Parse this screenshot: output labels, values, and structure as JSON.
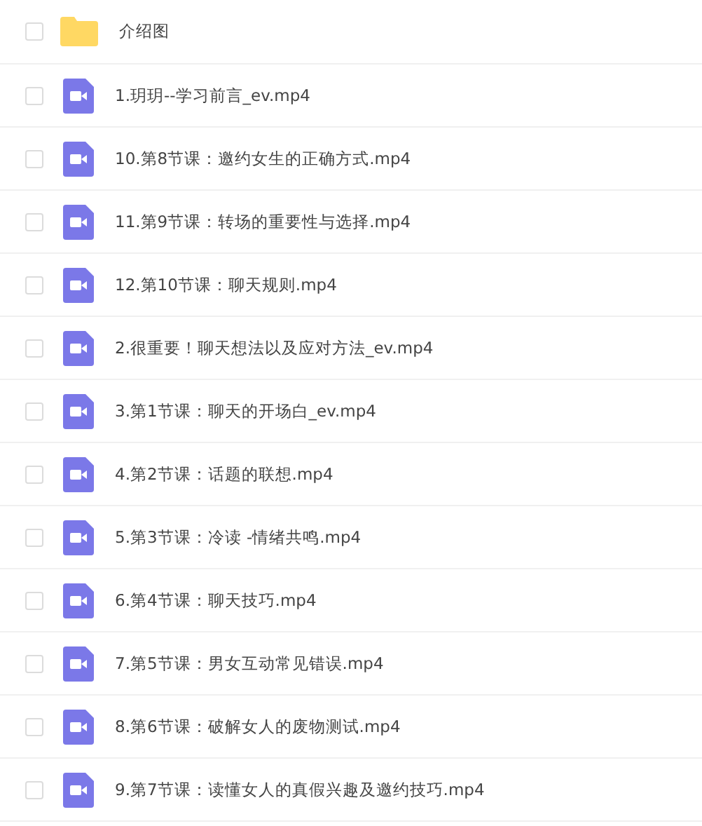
{
  "files": [
    {
      "kind": "folder",
      "name": "介绍图",
      "checked": false
    },
    {
      "kind": "video",
      "name": "1.玥玥--学习前言_ev.mp4",
      "checked": false
    },
    {
      "kind": "video",
      "name": "10.第8节课：邀约女生的正确方式.mp4",
      "checked": false
    },
    {
      "kind": "video",
      "name": "11.第9节课：转场的重要性与选择.mp4",
      "checked": false
    },
    {
      "kind": "video",
      "name": "12.第10节课：聊天规则.mp4",
      "checked": false
    },
    {
      "kind": "video",
      "name": "2.很重要！聊天想法以及应对方法_ev.mp4",
      "checked": false
    },
    {
      "kind": "video",
      "name": "3.第1节课：聊天的开场白_ev.mp4",
      "checked": false
    },
    {
      "kind": "video",
      "name": "4.第2节课：话题的联想.mp4",
      "checked": false
    },
    {
      "kind": "video",
      "name": "5.第3节课：冷读 -情绪共鸣.mp4",
      "checked": false
    },
    {
      "kind": "video",
      "name": "6.第4节课：聊天技巧.mp4",
      "checked": false
    },
    {
      "kind": "video",
      "name": "7.第5节课：男女互动常见错误.mp4",
      "checked": false
    },
    {
      "kind": "video",
      "name": "8.第6节课：破解女人的废物测试.mp4",
      "checked": false
    },
    {
      "kind": "video",
      "name": "9.第7节课：读懂女人的真假兴趣及邀约技巧.mp4",
      "checked": false
    }
  ]
}
